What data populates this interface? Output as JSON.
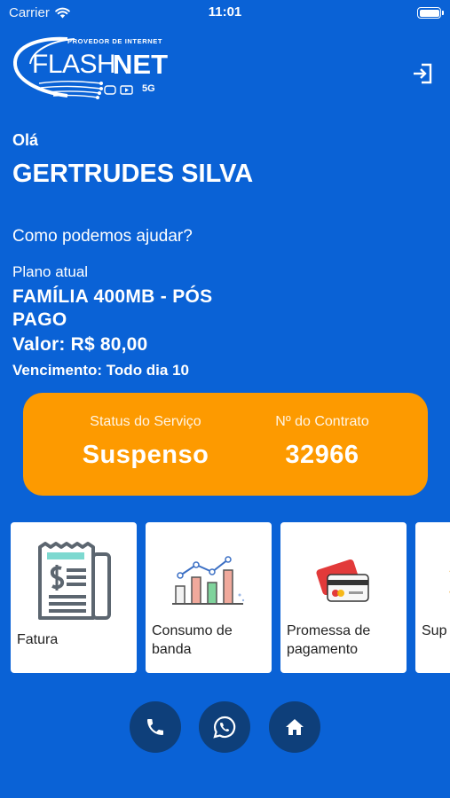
{
  "status_bar": {
    "carrier": "Carrier",
    "time": "11:01"
  },
  "logo": {
    "tagline": "PROVEDOR DE INTERNET",
    "brand_part1": "FLASH",
    "brand_part2": "NET",
    "badge": "5G"
  },
  "greeting": {
    "hello": "Olá",
    "name": "GERTRUDES SILVA",
    "help": "Como podemos ajudar?"
  },
  "plan": {
    "label": "Plano atual",
    "name": "FAMÍLIA 400MB - PÓS PAGO",
    "value": "Valor: R$ 80,00",
    "due": "Vencimento: Todo dia 10"
  },
  "status_card": {
    "service_label": "Status do Serviço",
    "service_value": "Suspenso",
    "contract_label": "Nº do Contrato",
    "contract_value": "32966"
  },
  "tiles": [
    {
      "label": "Fatura",
      "icon": "invoice-icon"
    },
    {
      "label": "Consumo de banda",
      "icon": "bar-chart-icon"
    },
    {
      "label": "Promessa de pagamento",
      "icon": "credit-card-icon"
    },
    {
      "label": "Sup",
      "icon": "support-icon"
    }
  ],
  "bottom_actions": [
    {
      "icon": "phone-icon"
    },
    {
      "icon": "whatsapp-icon"
    },
    {
      "icon": "home-icon"
    }
  ],
  "colors": {
    "background": "#0a62d6",
    "status_card": "#fd9a00",
    "round_button": "#0e3f7a"
  }
}
